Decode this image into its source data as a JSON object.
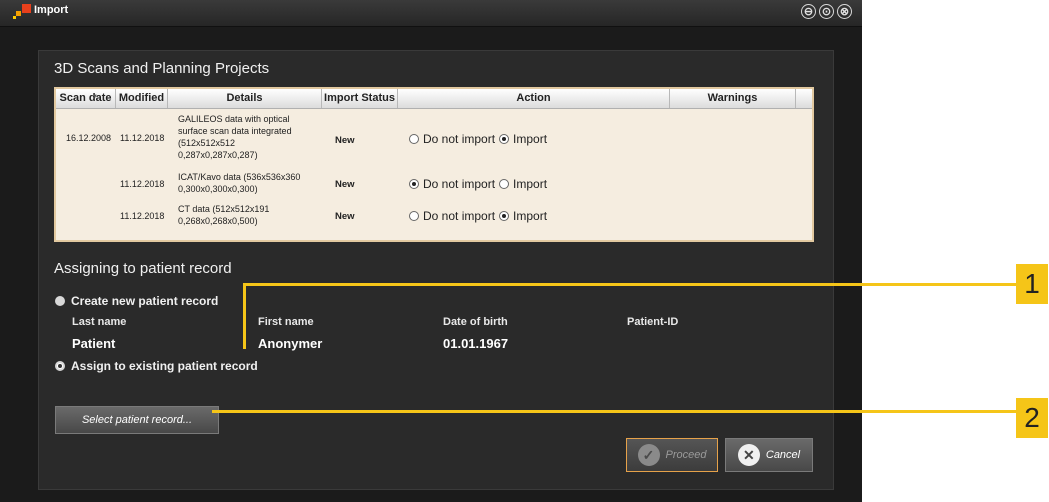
{
  "window": {
    "title": "Import",
    "controls": [
      "⊖",
      "⊙",
      "⊗"
    ]
  },
  "scans": {
    "title": "3D Scans and Planning Projects",
    "columns": [
      "Scan date",
      "Modified",
      "Details",
      "Import Status",
      "Action",
      "Warnings"
    ],
    "rows": [
      {
        "scan_date": "16.12.2008",
        "modified": "11.12.2018",
        "details": [
          "GALILEOS data with optical",
          "surface scan data integrated",
          "(512x512x512",
          "0,287x0,287x0,287)"
        ],
        "status": "New",
        "action_opt1": "Do not import",
        "action_opt2": "Import",
        "selected": "Import"
      },
      {
        "scan_date": "",
        "modified": "11.12.2018",
        "details": [
          "ICAT/Kavo data (536x536x360",
          "0,300x0,300x0,300)"
        ],
        "status": "New",
        "action_opt1": "Do not import",
        "action_opt2": "Import",
        "selected": "Do not import"
      },
      {
        "scan_date": "",
        "modified": "11.12.2018",
        "details": [
          "CT data (512x512x191",
          "0,268x0,268x0,500)"
        ],
        "status": "New",
        "action_opt1": "Do not import",
        "action_opt2": "Import",
        "selected": "Import"
      }
    ]
  },
  "assign": {
    "title": "Assigning to patient record",
    "create_new": "Create new patient record",
    "assign_existing": "Assign to existing patient record",
    "selected": "Assign to existing patient record",
    "labels": {
      "last_name": "Last name",
      "first_name": "First name",
      "dob": "Date of birth",
      "patient_id": "Patient-ID"
    },
    "values": {
      "last_name": "Patient",
      "first_name": "Anonymer",
      "dob": "01.01.1967",
      "patient_id": ""
    }
  },
  "buttons": {
    "select_patient": "Select patient record...",
    "proceed": "Proceed",
    "cancel": "Cancel"
  },
  "callouts": [
    "1",
    "2"
  ],
  "colors": {
    "accent": "#f5c518",
    "proceed_border": "#e6a24a",
    "table_border": "#e2c9a0"
  }
}
